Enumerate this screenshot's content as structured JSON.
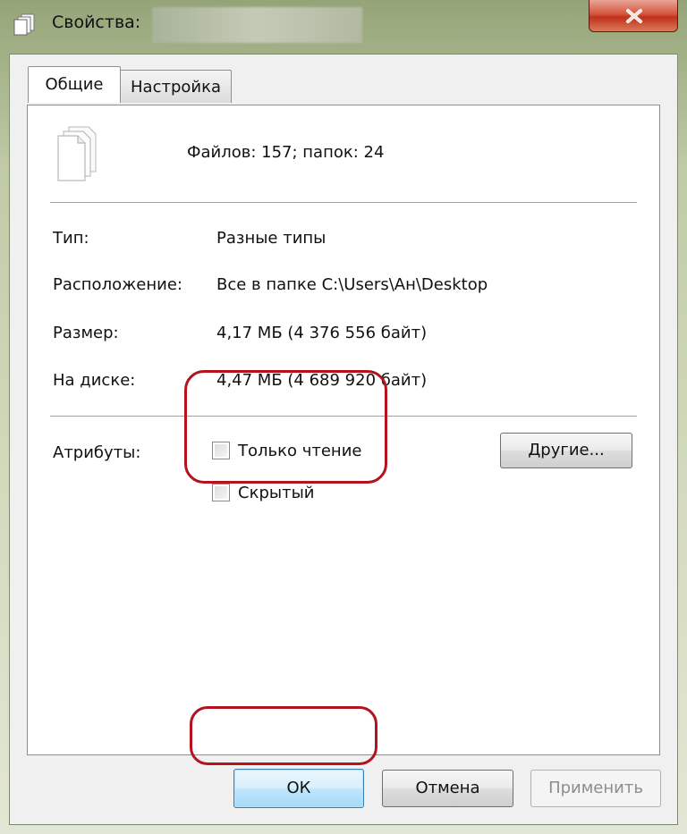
{
  "window": {
    "title": "Свойства:"
  },
  "tabs": [
    {
      "label": "Общие",
      "active": true
    },
    {
      "label": "Настройка",
      "active": false
    }
  ],
  "summary": {
    "files_count_text": "Файлов: 157; папок: 24"
  },
  "properties": [
    {
      "label": "Тип:",
      "value": "Разные типы"
    },
    {
      "label": "Расположение:",
      "value": "Все в папке C:\\Users\\Ан\\Desktop"
    },
    {
      "label": "Размер:",
      "value": "4,17 МБ (4 376 556 байт)"
    },
    {
      "label": "На диске:",
      "value": "4,47 МБ (4 689 920 байт)"
    }
  ],
  "attributes": {
    "label": "Атрибуты:",
    "read_only": {
      "label": "Только чтение",
      "checked": false
    },
    "hidden": {
      "label": "Скрытый",
      "checked": false
    },
    "other_button": "Другие..."
  },
  "buttons": {
    "ok": "ОК",
    "cancel": "Отмена",
    "apply": "Применить",
    "apply_enabled": false
  },
  "colors": {
    "highlight": "#b3121e",
    "close_button": "#c1301a",
    "ok_button_border": "#3c7fb1"
  },
  "icons": {
    "title": "files-icon",
    "close": "close-icon",
    "files": "multiple-files-icon"
  }
}
